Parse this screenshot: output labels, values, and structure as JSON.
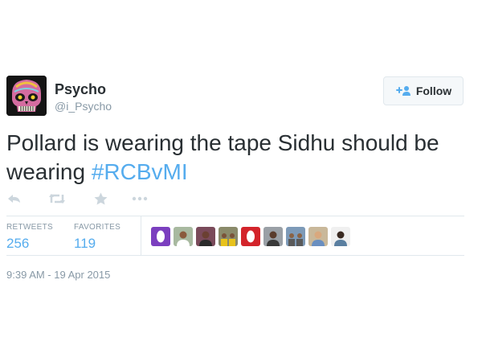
{
  "user": {
    "display_name": "Psycho",
    "handle": "@i_Psycho",
    "avatar_icon": "skull-avatar"
  },
  "follow_button": {
    "label": "Follow",
    "icon": "add-person-icon"
  },
  "tweet": {
    "text_plain": "Pollard is wearing the tape Sidhu should be wearing ",
    "hashtag": "#RCBvMI"
  },
  "actions": [
    {
      "name": "reply",
      "icon": "reply-icon"
    },
    {
      "name": "retweet",
      "icon": "retweet-icon"
    },
    {
      "name": "favorite",
      "icon": "star-icon"
    },
    {
      "name": "more",
      "icon": "more-icon"
    }
  ],
  "stats": {
    "retweets_label": "RETWEETS",
    "retweets_count": "256",
    "favorites_label": "FAVORITES",
    "favorites_count": "119"
  },
  "favoriters": [
    {
      "kind": "logo",
      "bg": "#7b3fbf",
      "fg": "#ffffff"
    },
    {
      "kind": "person",
      "bg": "#a8b9a0",
      "skin": "#8a5a3c",
      "shirt": "#ffffff"
    },
    {
      "kind": "person",
      "bg": "#7a4a5a",
      "skin": "#6b4032",
      "shirt": "#2a2a2a"
    },
    {
      "kind": "group",
      "bg": "#8a8a6a",
      "skin": "#7a5238",
      "shirt": "#e8c21a"
    },
    {
      "kind": "logo",
      "bg": "#d3242b",
      "fg": "#ffffff"
    },
    {
      "kind": "person",
      "bg": "#9aa0a6",
      "skin": "#5a3c2c",
      "shirt": "#3a3a3a"
    },
    {
      "kind": "group",
      "bg": "#7d9ab8",
      "skin": "#8a6245",
      "shirt": "#5a5a5a"
    },
    {
      "kind": "person",
      "bg": "#c9b89a",
      "skin": "#d9a87e",
      "shirt": "#6a8fc0"
    },
    {
      "kind": "person",
      "bg": "#f0f0f0",
      "skin": "#3a2a22",
      "shirt": "#5a7fa0"
    }
  ],
  "timestamp": "9:39 AM - 19 Apr 2015",
  "colors": {
    "link_blue": "#55acee",
    "text_dark": "#292f33",
    "muted_gray": "#8899a6",
    "icon_gray": "#ccd6dd",
    "divider": "#e1e8ed"
  }
}
